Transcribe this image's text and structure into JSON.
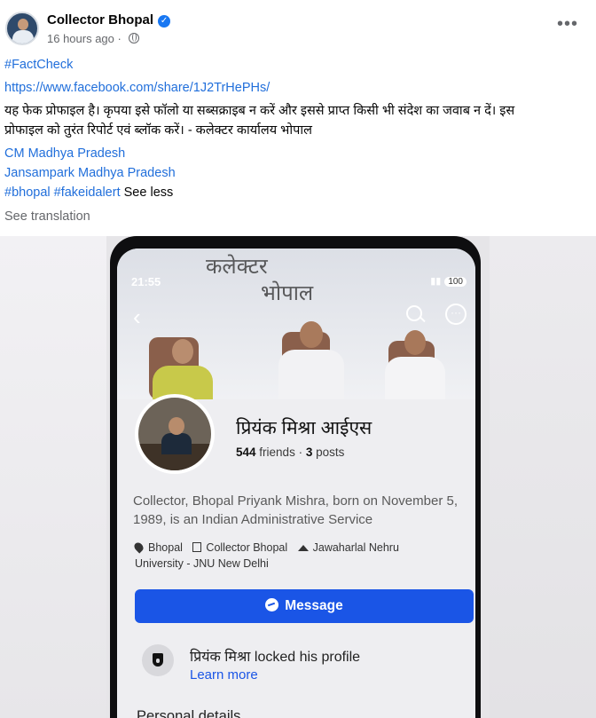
{
  "post": {
    "author": "Collector Bhopal",
    "time": "16 hours ago",
    "more_label": "•••",
    "hashtag_top": "#FactCheck",
    "url": "https://www.facebook.com/share/1J2TrHePHs/",
    "text_line1": "यह फेक प्रोफाइल है। कृपया इसे फॉलो या सब्सक्राइब न करें और इससे प्राप्त किसी भी संदेश का जवाब न दें। इस",
    "text_line2": "प्रोफाइल को तुरंत रिपोर्ट एवं ब्लॉक करें। - कलेक्टर कार्यालय भोपाल",
    "mention1": "CM Madhya Pradesh",
    "mention2": "Jansampark Madhya Pradesh",
    "hashtags_bottom": "#bhopal #fakeidalert",
    "see_less": "See less",
    "see_translation": "See translation"
  },
  "screenshot": {
    "status_time": "21:55",
    "battery": "100",
    "cover_text_line1": "कलेक्टर",
    "cover_text_line2": "भोपाल",
    "profile_name": "प्रियंक मिश्रा आईएस",
    "friends_count": "544",
    "friends_label": "friends",
    "separator": "·",
    "posts_count": "3",
    "posts_label": "posts",
    "bio_line1": "Collector, Bhopal Priyank Mishra, born on November 5,",
    "bio_line2": "1989, is an Indian Administrative Service",
    "detail_location": "Bhopal",
    "detail_work": "Collector Bhopal",
    "detail_edu_line1": "Jawaharlal Nehru",
    "detail_edu_line2": "University - JNU New Delhi",
    "message_button": "Message",
    "locked_text": "प्रियंक मिश्रा locked his profile",
    "learn_more": "Learn more",
    "personal_details": "Personal details"
  },
  "colors": {
    "link": "#216fdb",
    "message_button": "#1a55e6",
    "verified": "#1877f2"
  }
}
